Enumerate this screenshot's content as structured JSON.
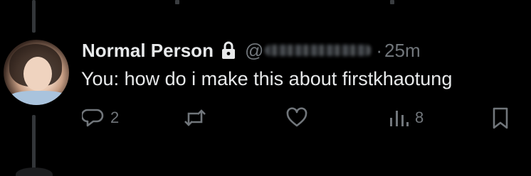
{
  "tweet": {
    "display_name": "Normal Person",
    "handle_prefix": "@",
    "dot": "·",
    "time": "25m",
    "text": "You: how do i make this about firstkhaotung"
  },
  "actions": {
    "reply_count": "2",
    "repost_count": "",
    "like_count": "",
    "views_count": "8"
  },
  "icons": {
    "lock": "lock-icon",
    "reply": "reply-icon",
    "repost": "repost-icon",
    "like": "heart-icon",
    "views": "analytics-icon",
    "bookmark": "bookmark-icon"
  },
  "colors": {
    "background": "#000000",
    "text_primary": "#e7e9ea",
    "text_secondary": "#71767b",
    "thread_line": "#333639"
  }
}
